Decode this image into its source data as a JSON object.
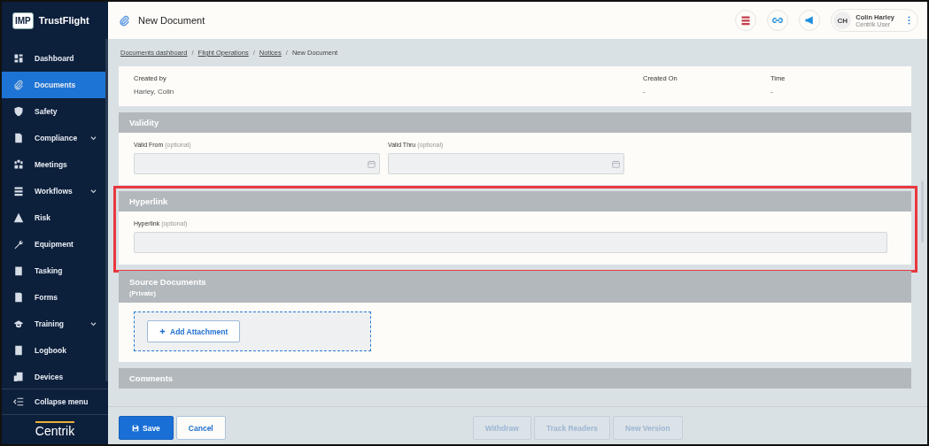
{
  "sidebar": {
    "brand": {
      "badge": "IMP",
      "name": "TrustFlight"
    },
    "items": [
      {
        "label": "Dashboard",
        "selected": false,
        "expandable": false
      },
      {
        "label": "Documents",
        "selected": true,
        "expandable": false
      },
      {
        "label": "Safety",
        "selected": false,
        "expandable": false
      },
      {
        "label": "Compliance",
        "selected": false,
        "expandable": true
      },
      {
        "label": "Meetings",
        "selected": false,
        "expandable": false
      },
      {
        "label": "Workflows",
        "selected": false,
        "expandable": true
      },
      {
        "label": "Risk",
        "selected": false,
        "expandable": false
      },
      {
        "label": "Equipment",
        "selected": false,
        "expandable": false
      },
      {
        "label": "Tasking",
        "selected": false,
        "expandable": false
      },
      {
        "label": "Forms",
        "selected": false,
        "expandable": false
      },
      {
        "label": "Training",
        "selected": false,
        "expandable": true
      },
      {
        "label": "Logbook",
        "selected": false,
        "expandable": false
      },
      {
        "label": "Devices",
        "selected": false,
        "expandable": false
      }
    ],
    "collapse": "Collapse menu",
    "footer_logo": "Centrik"
  },
  "header": {
    "title": "New Document",
    "user": {
      "initials": "CH",
      "name": "Colin Harley",
      "role": "Centrik User"
    }
  },
  "breadcrumb": [
    {
      "label": "Documents dashboard",
      "kind": "link"
    },
    {
      "label": "/",
      "kind": "separator"
    },
    {
      "label": "Flight Operations",
      "kind": "link"
    },
    {
      "label": "/",
      "kind": "separator"
    },
    {
      "label": "Notices",
      "kind": "link"
    },
    {
      "label": "/",
      "kind": "separator"
    },
    {
      "label": "New Document",
      "kind": "current"
    }
  ],
  "info": [
    {
      "label": "Created by",
      "value": "Harley, Colin"
    },
    {
      "label": "Created On",
      "value": "-"
    },
    {
      "label": "Time",
      "value": "-"
    }
  ],
  "validity": {
    "title": "Validity",
    "fields": [
      {
        "label": "Valid From",
        "hint": "(optional)"
      },
      {
        "label": "Valid Thru",
        "hint": "(optional)"
      }
    ]
  },
  "hyperlink": {
    "title": "Hyperlink",
    "highlighted": true,
    "field": {
      "label": "Hyperlink",
      "hint": "(optional)"
    }
  },
  "source": {
    "title": "Source Documents",
    "subtitle": "(Private)",
    "button": "Add Attachment"
  },
  "comments": {
    "title": "Comments"
  },
  "footer": {
    "buttons": [
      {
        "label": "Save",
        "kind": "primary",
        "disabled": false
      },
      {
        "label": "Cancel",
        "kind": "secondary",
        "disabled": false
      },
      {
        "label": "Withdraw",
        "kind": "secondary",
        "disabled": true
      },
      {
        "label": "Track Readers",
        "kind": "secondary",
        "disabled": true
      },
      {
        "label": "New Version",
        "kind": "secondary",
        "disabled": true
      }
    ]
  }
}
